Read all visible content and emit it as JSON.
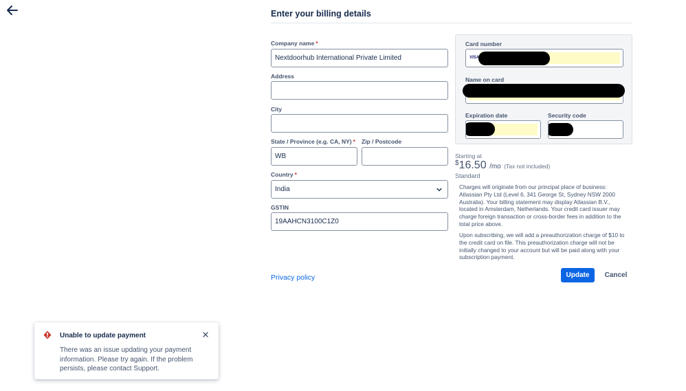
{
  "header": {
    "back_icon": "arrow-left-icon",
    "title": "Enter your billing details"
  },
  "form": {
    "company": {
      "label": "Company name",
      "required_mark": "*",
      "value": "Nextdoorhub International Private Limited"
    },
    "address": {
      "label": "Address",
      "value": ""
    },
    "city": {
      "label": "City",
      "value": ""
    },
    "state": {
      "label": "State / Province (e.g. CA, NY)",
      "required_mark": "*",
      "value": "WB"
    },
    "zip": {
      "label": "Zip / Postcode",
      "value": ""
    },
    "country": {
      "label": "Country",
      "required_mark": "*",
      "value": "India",
      "icon": "chevron-down-icon"
    },
    "gstin": {
      "label": "GSTIN",
      "value": "19AAHCN3100C1Z0"
    }
  },
  "card": {
    "card_number_label": "Card number",
    "card_brand": "VISA",
    "name_on_card_label": "Name on card",
    "expiration_label": "Expiration date",
    "security_label": "Security code"
  },
  "pricing": {
    "starting_at": "Starting at",
    "currency": "$",
    "amount": "16.50",
    "per": "/mo",
    "tax_note": "(Tax not included)",
    "plan": "Standard"
  },
  "notices": {
    "charges": "Charges will originate from our principal place of business: Atlassian Pty Ltd (Level 6, 341 George St, Sydney NSW 2000 Australia). Your billing statement may display Atlassian B.V., located in Amsterdam, Netherlands. Your credit card issuer may charge foreign transaction or cross-border fees in addition to the total price above.",
    "preauth": "Upon subscribing, we will add a preauthorization charge of $10 to the credit card on file. This preauthorization charge will not be initially changed to your account but will be paid along with your subscription payment."
  },
  "footer": {
    "privacy_link": "Privacy policy",
    "update_label": "Update",
    "cancel_label": "Cancel"
  },
  "toast": {
    "icon": "error-icon",
    "title": "Unable to update payment",
    "message": "There was an issue updating your payment information. Please try again. If the problem persists, please contact Support.",
    "close_icon": "close-icon"
  },
  "colors": {
    "primary": "#0c66e4",
    "error": "#c9372c",
    "text": "#172b4d",
    "subtle_text": "#44546f",
    "autofill": "#fefbc6"
  }
}
